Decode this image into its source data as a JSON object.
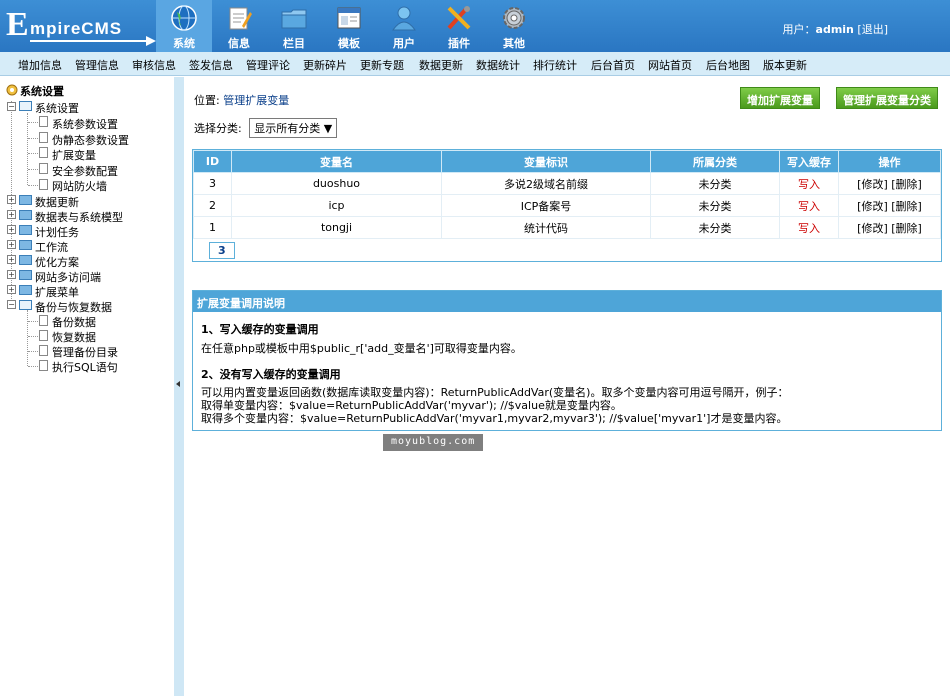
{
  "logo": {
    "first": "E",
    "rest": "mpireCMS"
  },
  "topnav": [
    {
      "label": "系统",
      "icon": "globe-icon",
      "active": true
    },
    {
      "label": "信息",
      "icon": "notepad-icon"
    },
    {
      "label": "栏目",
      "icon": "folder-icon"
    },
    {
      "label": "模板",
      "icon": "window-icon"
    },
    {
      "label": "用户",
      "icon": "user-icon"
    },
    {
      "label": "插件",
      "icon": "tools-icon"
    },
    {
      "label": "其他",
      "icon": "gear-icon"
    }
  ],
  "user": {
    "prefix": "用户：",
    "name": "admin",
    "logout": "[退出]"
  },
  "menubar": [
    "增加信息",
    "管理信息",
    "审核信息",
    "签发信息",
    "管理评论",
    "更新碎片",
    "更新专题",
    "数据更新",
    "数据统计",
    "排行统计",
    "后台首页",
    "网站首页",
    "后台地图",
    "版本更新"
  ],
  "sidebar": {
    "title": "系统设置",
    "nodes": [
      {
        "label": "系统设置",
        "level": 1,
        "type": "open"
      },
      {
        "label": "系统参数设置",
        "level": 2
      },
      {
        "label": "伪静态参数设置",
        "level": 2
      },
      {
        "label": "扩展变量",
        "level": 2
      },
      {
        "label": "安全参数配置",
        "level": 2
      },
      {
        "label": "网站防火墙",
        "level": 2
      },
      {
        "label": "数据更新",
        "level": 1,
        "type": "closed"
      },
      {
        "label": "数据表与系统模型",
        "level": 1,
        "type": "closed"
      },
      {
        "label": "计划任务",
        "level": 1,
        "type": "closed"
      },
      {
        "label": "工作流",
        "level": 1,
        "type": "closed"
      },
      {
        "label": "优化方案",
        "level": 1,
        "type": "closed"
      },
      {
        "label": "网站多访问端",
        "level": 1,
        "type": "closed"
      },
      {
        "label": "扩展菜单",
        "level": 1,
        "type": "closed"
      },
      {
        "label": "备份与恢复数据",
        "level": 1,
        "type": "open"
      },
      {
        "label": "备份数据",
        "level": 2
      },
      {
        "label": "恢复数据",
        "level": 2
      },
      {
        "label": "管理备份目录",
        "level": 2
      },
      {
        "label": "执行SQL语句",
        "level": 2
      }
    ]
  },
  "main": {
    "position_prefix": "位置: ",
    "position_link": "管理扩展变量",
    "btn_add": "增加扩展变量",
    "btn_manage": "管理扩展变量分类",
    "category_label": "选择分类:",
    "category_value": "显示所有分类",
    "table": {
      "headers": [
        "ID",
        "变量名",
        "变量标识",
        "所属分类",
        "写入缓存",
        "操作"
      ],
      "rows": [
        {
          "id": "3",
          "name": "duoshuo",
          "tag": "多说2级域名前缀",
          "cat": "未分类",
          "cache": "写入",
          "ops": "[修改] [删除]"
        },
        {
          "id": "2",
          "name": "icp",
          "tag": "ICP备案号",
          "cat": "未分类",
          "cache": "写入",
          "ops": "[修改] [删除]"
        },
        {
          "id": "1",
          "name": "tongji",
          "tag": "统计代码",
          "cat": "未分类",
          "cache": "写入",
          "ops": "[修改] [删除]"
        }
      ],
      "pager": "3"
    },
    "help": {
      "title": "扩展变量调用说明",
      "h1": "1、写入缓存的变量调用",
      "p1": "在任意php或模板中用$public_r['add_变量名']可取得变量内容。",
      "h2": "2、没有写入缓存的变量调用",
      "p2": "可以用内置变量返回函数(数据库读取变量内容)：ReturnPublicAddVar(变量名)。取多个变量内容可用逗号隔开，例子：\n取得单变量内容：$value=ReturnPublicAddVar('myvar'); //$value就是变量内容。\n取得多个变量内容：$value=ReturnPublicAddVar('myvar1,myvar2,myvar3'); //$value['myvar1']才是变量内容。"
    }
  },
  "watermark": "moyublog.com",
  "colors": {
    "header": "#2a76c2",
    "menubar": "#d6ecf8",
    "table_head": "#4ea5d8",
    "green_button": "#5aaa28",
    "link": "#0a3f8a",
    "cache_red": "#cc0000"
  }
}
